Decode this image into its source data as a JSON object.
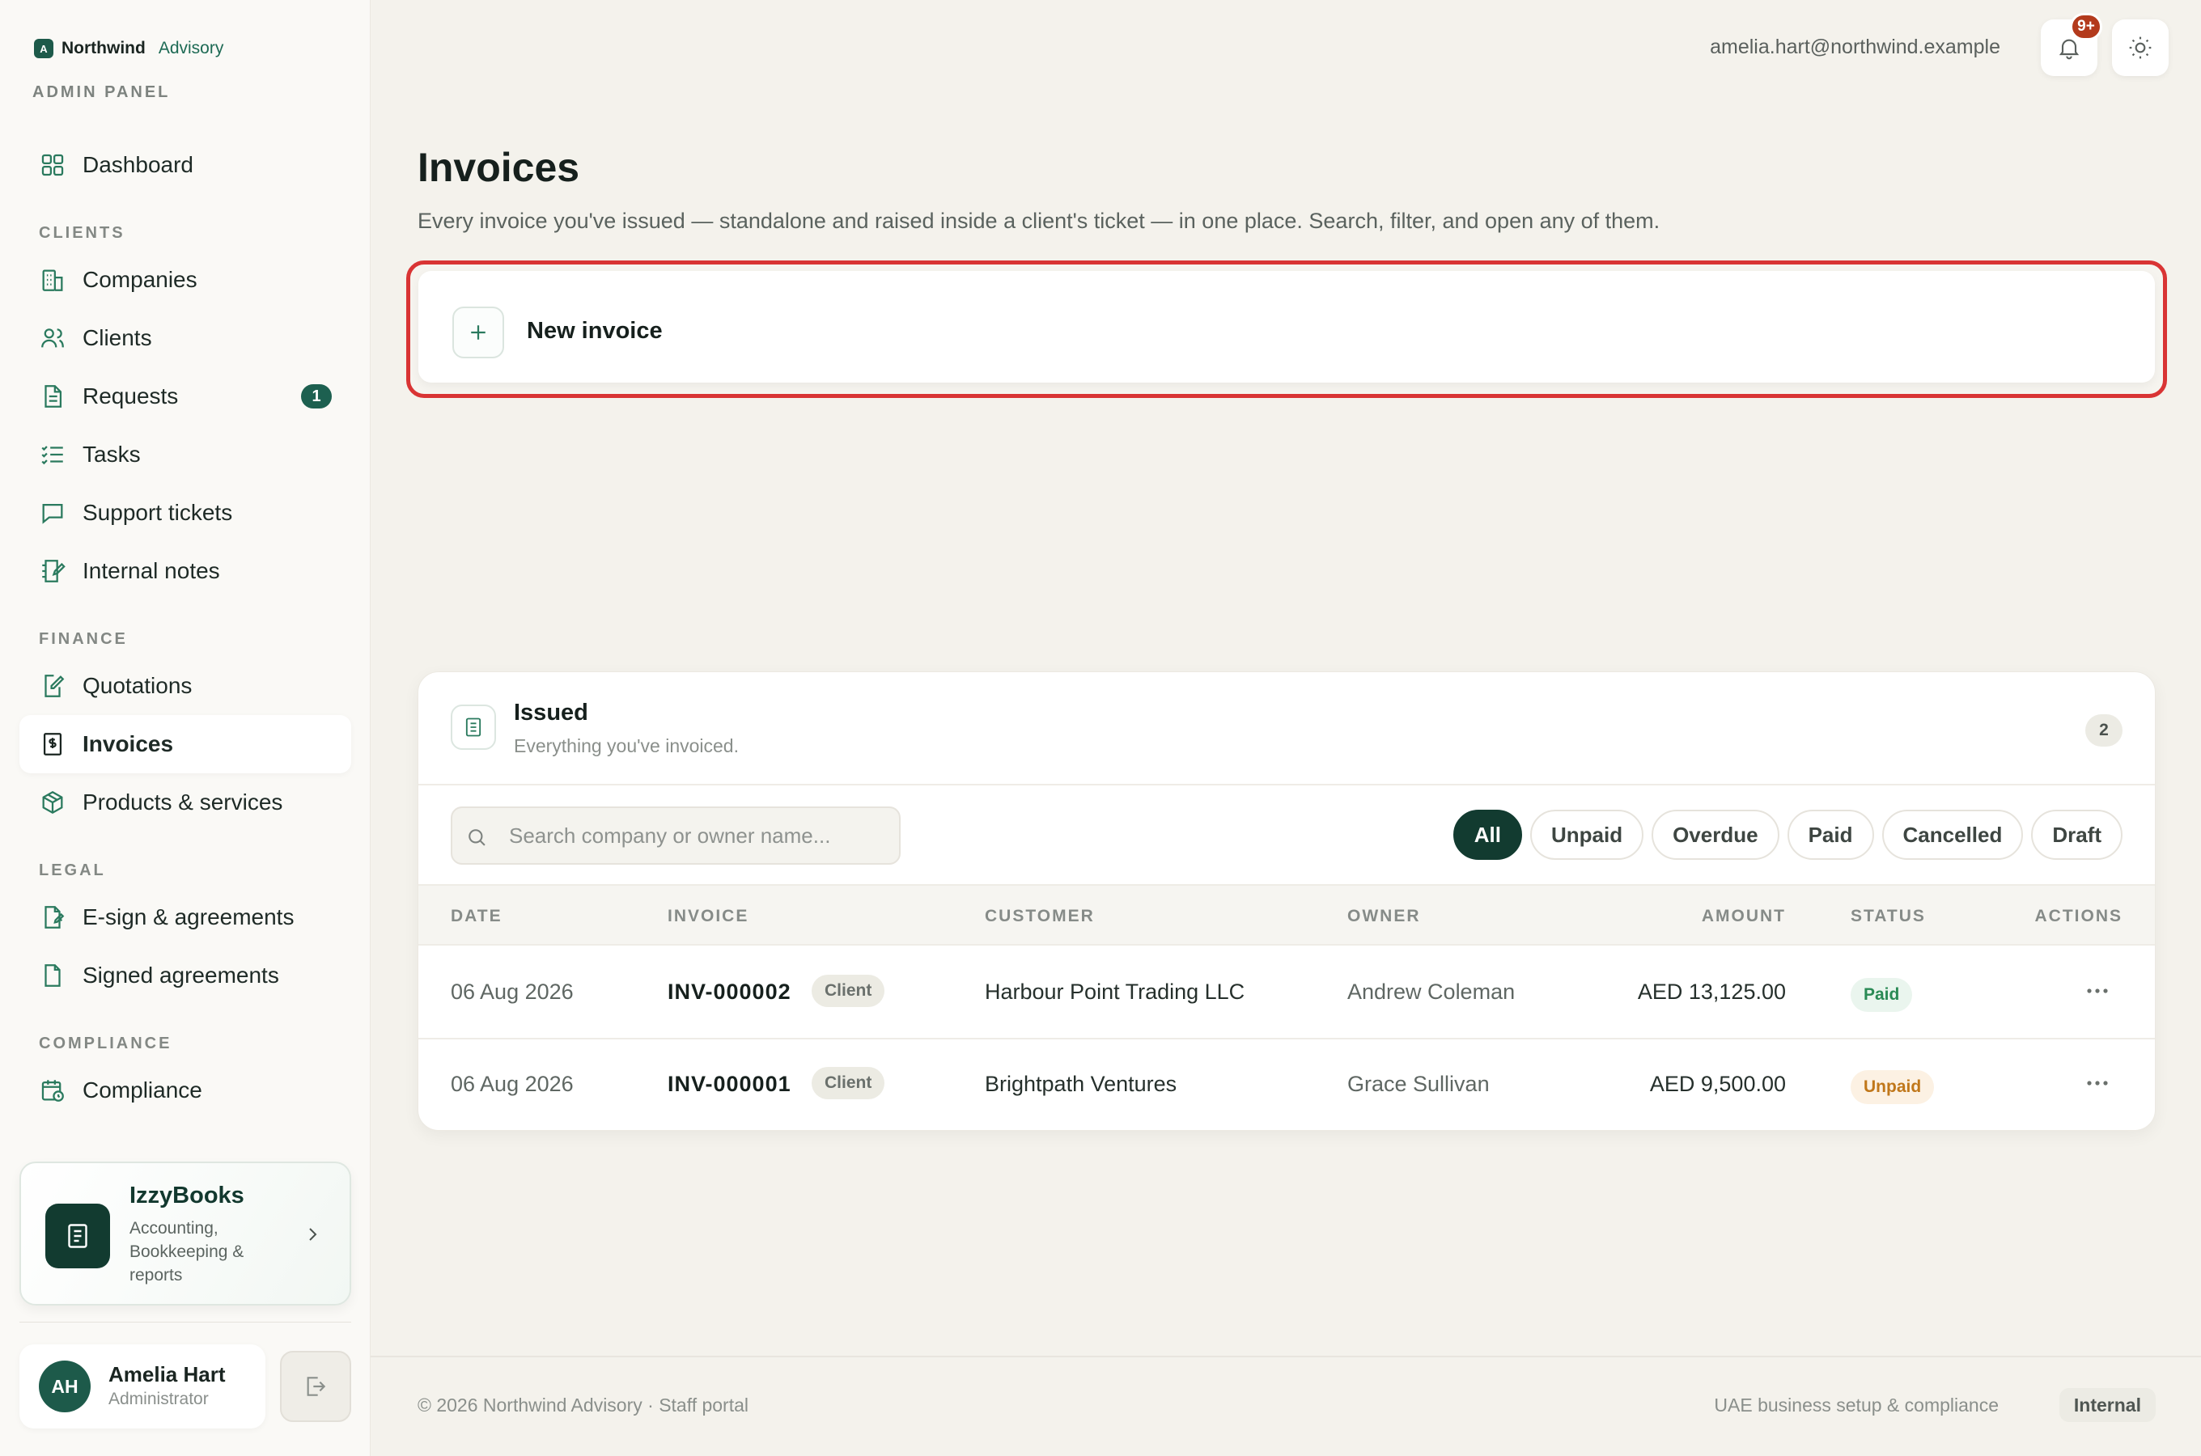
{
  "brand": {
    "logo_letter": "A",
    "name": "Northwind",
    "suffix": "Advisory",
    "panel": "ADMIN PANEL"
  },
  "sidebar": {
    "dashboard": "Dashboard",
    "sections": {
      "clients": "CLIENTS",
      "finance": "FINANCE",
      "legal": "LEGAL",
      "compliance": "COMPLIANCE"
    },
    "items": {
      "companies": "Companies",
      "clients": "Clients",
      "requests": "Requests",
      "requests_badge": "1",
      "tasks": "Tasks",
      "support_tickets": "Support tickets",
      "internal_notes": "Internal notes",
      "quotations": "Quotations",
      "invoices": "Invoices",
      "products_services": "Products & services",
      "esign": "E-sign & agreements",
      "signed_agreements": "Signed agreements",
      "compliance": "Compliance"
    },
    "promo": {
      "title": "IzzyBooks",
      "description": "Accounting, Bookkeeping & reports"
    },
    "user": {
      "initials": "AH",
      "name": "Amelia Hart",
      "role": "Administrator"
    }
  },
  "topbar": {
    "email": "amelia.hart@northwind.example",
    "notifications_badge": "9+"
  },
  "main": {
    "title": "Invoices",
    "description": "Every invoice you've issued — standalone and raised inside a client's ticket — in one place. Search, filter, and open any of them.",
    "new_invoice_label": "New invoice"
  },
  "issued": {
    "title": "Issued",
    "subtitle": "Everything you've invoiced.",
    "count": "2",
    "search_placeholder": "Search company or owner name...",
    "filters": [
      "All",
      "Unpaid",
      "Overdue",
      "Paid",
      "Cancelled",
      "Draft"
    ],
    "active_filter": "All",
    "columns": [
      "DATE",
      "INVOICE",
      "CUSTOMER",
      "OWNER",
      "AMOUNT",
      "STATUS",
      "ACTIONS"
    ],
    "rows": [
      {
        "date": "06 Aug 2026",
        "invoice": "INV-000002",
        "tag": "Client",
        "customer": "Harbour Point Trading LLC",
        "owner": "Andrew Coleman",
        "amount": "AED 13,125.00",
        "status": "Paid"
      },
      {
        "date": "06 Aug 2026",
        "invoice": "INV-000001",
        "tag": "Client",
        "customer": "Brightpath Ventures",
        "owner": "Grace Sullivan",
        "amount": "AED 9,500.00",
        "status": "Unpaid"
      }
    ]
  },
  "footer": {
    "left": "© 2026 Northwind Advisory · Staff portal",
    "right": "UAE business setup & compliance",
    "tag": "Internal"
  },
  "colors": {
    "accent": "#1d5a4a",
    "highlight_border": "#d93434",
    "paid": "#2a8a55",
    "unpaid": "#c0771a"
  }
}
